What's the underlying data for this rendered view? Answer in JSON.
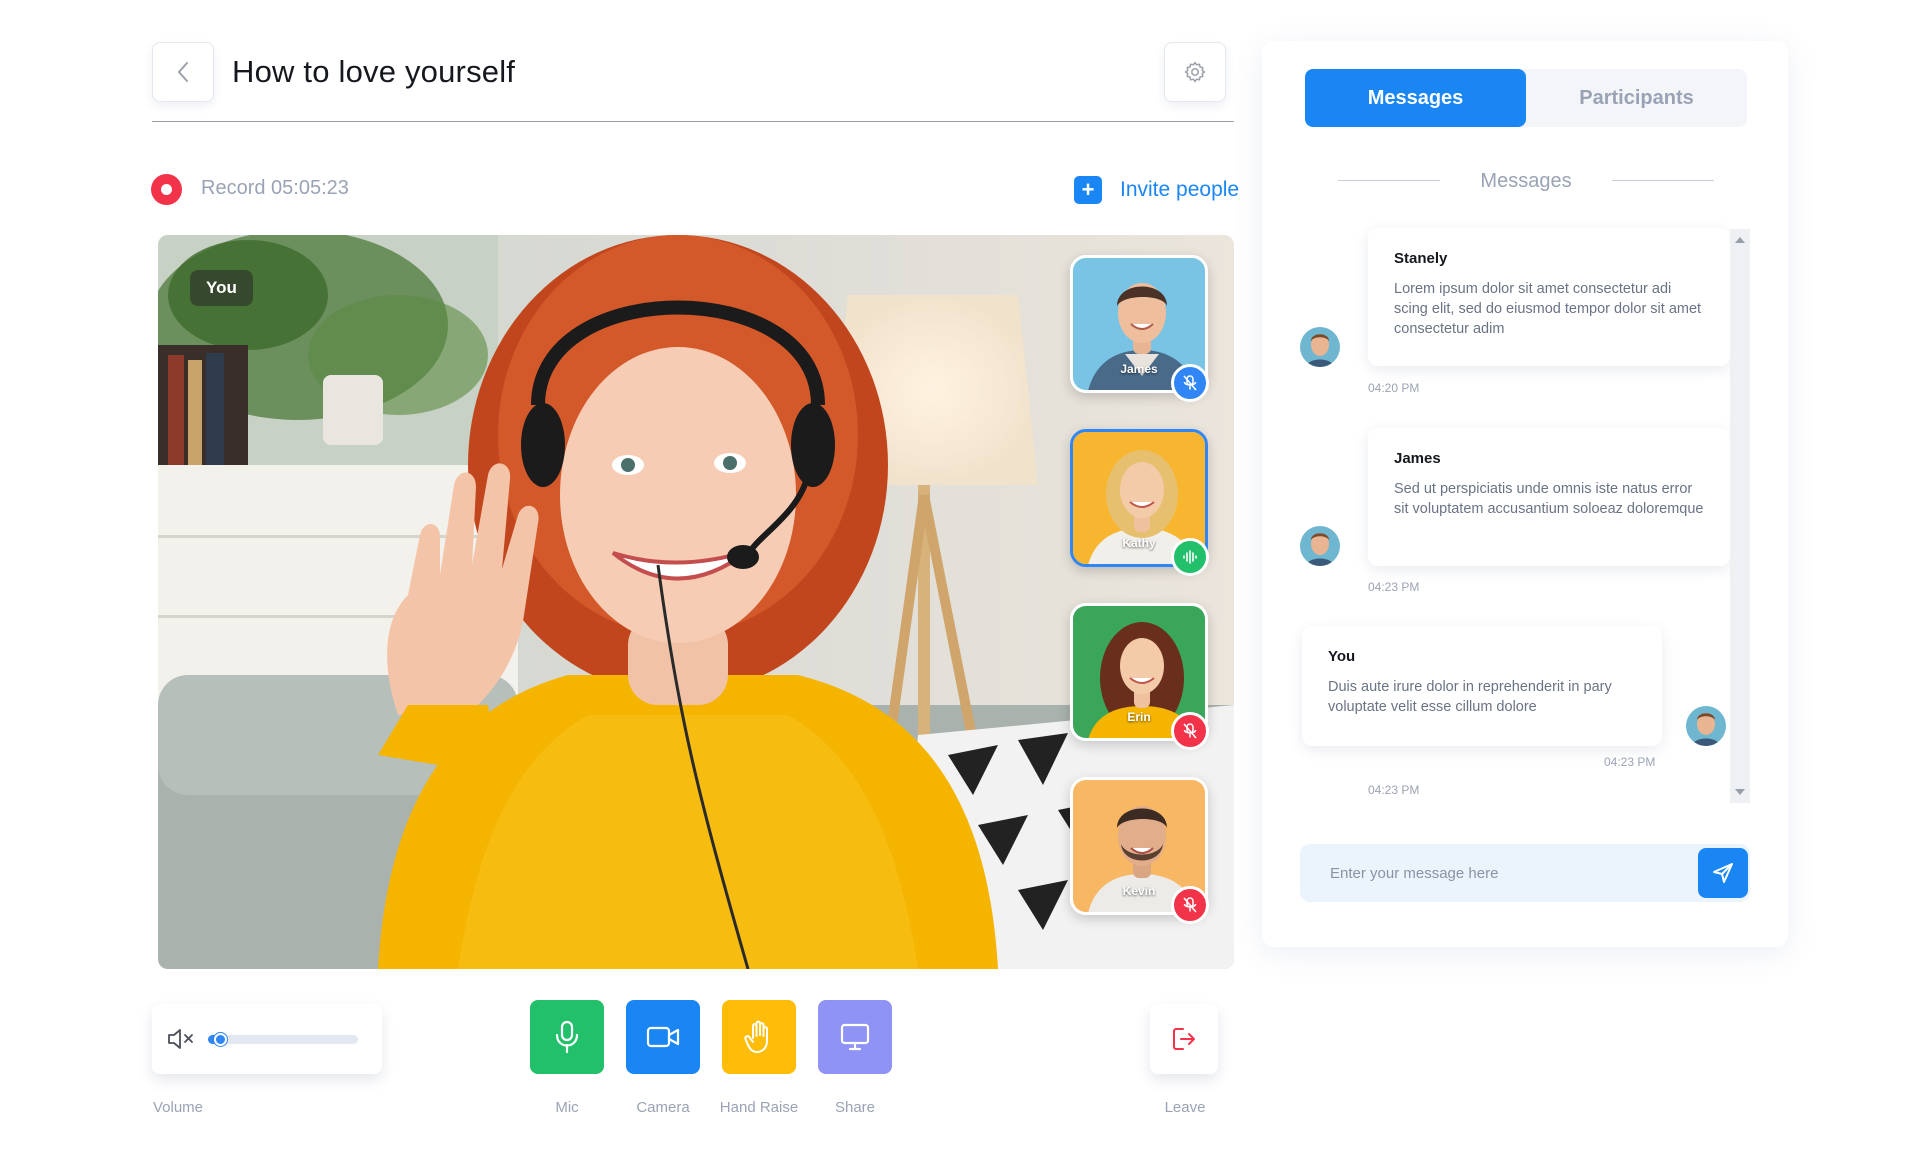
{
  "header": {
    "title": "How to love yourself"
  },
  "record": {
    "text": "Record 05:05:23"
  },
  "invite": {
    "label": "Invite people"
  },
  "video": {
    "self_label": "You"
  },
  "participants": [
    {
      "name": "James",
      "mic": "muted",
      "accent": "#2f86f4"
    },
    {
      "name": "Kathy",
      "mic": "speaking",
      "accent": "#22c06a"
    },
    {
      "name": "Erin",
      "mic": "muted",
      "accent": "#f2334a"
    },
    {
      "name": "Kevin",
      "mic": "muted",
      "accent": "#f2334a"
    }
  ],
  "controls": {
    "volume_label": "Volume",
    "volume_level": 0.08,
    "mic_label": "Mic",
    "camera_label": "Camera",
    "hand_label": "Hand Raise",
    "share_label": "Share",
    "leave_label": "Leave"
  },
  "colors": {
    "primary": "#1a86f4",
    "mic": "#22c06a",
    "camera": "#1a86f4",
    "hand": "#ffbd0a",
    "share": "#8e93f5",
    "record": "#f2334a"
  },
  "panel": {
    "tabs": [
      {
        "label": "Messages",
        "active": true
      },
      {
        "label": "Participants",
        "active": false
      }
    ],
    "section_title": "Messages",
    "messages": [
      {
        "sender": "Stanely",
        "text": "Lorem ipsum dolor sit amet consectetur adi scing elit, sed do eiusmod tempor dolor sit amet consectetur adim",
        "time": "04:20 PM"
      },
      {
        "sender": "James",
        "text": "Sed ut perspiciatis unde omnis iste natus error sit voluptatem accusantium soloeaz doloremque",
        "time": "04:23 PM"
      },
      {
        "sender": "You",
        "text": "Duis aute irure dolor in reprehenderit in pary voluptate velit esse cillum dolore",
        "time": "04:23 PM",
        "time_extra": "04:23 PM"
      }
    ],
    "input_placeholder": "Enter your message here"
  }
}
